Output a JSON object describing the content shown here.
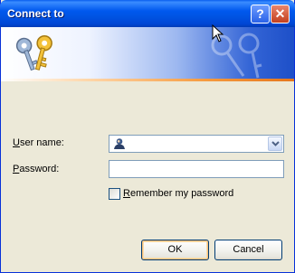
{
  "window": {
    "title": "Connect to"
  },
  "titlebar": {
    "help_glyph": "?",
    "close_glyph": "✕",
    "help_icon": "help-icon",
    "close_icon": "close-icon"
  },
  "banner": {
    "icon": "keys-icon",
    "accent_color": "#f59a3e",
    "brand_color": "#0054e3"
  },
  "form": {
    "user_label_prefix": "",
    "user_label_mnemonic": "U",
    "user_label_rest": "ser name:",
    "user_value": "",
    "password_label_mnemonic": "P",
    "password_label_rest": "assword:",
    "password_value": "",
    "remember_mnemonic": "R",
    "remember_rest": "emember my password",
    "remember_checked": false
  },
  "buttons": {
    "ok": "OK",
    "cancel": "Cancel"
  }
}
